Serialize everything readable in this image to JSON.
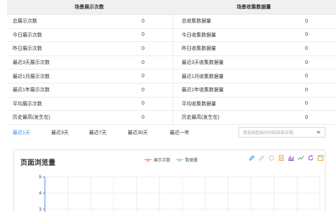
{
  "stats": {
    "left_title": "场景展示次数",
    "right_title": "场景收集数据量",
    "rows": [
      {
        "left_label": "总展示次数",
        "left_value": "0",
        "right_label": "总收集数据量",
        "right_value": "0"
      },
      {
        "left_label": "今日展示次数",
        "left_value": "0",
        "right_label": "今日收集数据量",
        "right_value": "0"
      },
      {
        "left_label": "昨日展示次数",
        "left_value": "0",
        "right_label": "昨日收集数据量",
        "right_value": "0"
      },
      {
        "left_label": "最近3天展示次数",
        "left_value": "0",
        "right_label": "最近3天收集数据量",
        "right_value": "0"
      },
      {
        "left_label": "最近1月展示次数",
        "left_value": "0",
        "right_label": "最近1月收集数据量",
        "right_value": "0"
      },
      {
        "left_label": "最近1年展示次数",
        "left_value": "0",
        "right_label": "最近1年收集数据量",
        "right_value": "0"
      },
      {
        "left_label": "平均展示次数",
        "left_value": "0",
        "right_label": "平均收集数据量",
        "right_value": "0"
      },
      {
        "left_label": "历史最高(发生在)",
        "left_value": "0",
        "right_label": "历史最高(发生在)",
        "right_value": "0"
      }
    ]
  },
  "range_tabs": {
    "items": [
      "最近1天",
      "最近3天",
      "最近7天",
      "最近30天",
      "最近一年"
    ],
    "active_index": 0
  },
  "date_picker": {
    "placeholder": "请选择起始时间和结束日期"
  },
  "chart_panel": {
    "title": "页面浏览量",
    "tools": [
      "edit-icon",
      "edit-disabled-icon",
      "restore-icon",
      "data-view-icon",
      "bar-chart-icon",
      "line-chart-icon",
      "refresh-icon",
      "save-image-icon"
    ],
    "tool_colors": [
      "#3b8ee3",
      "#c8c8c8",
      "#c8c8c8",
      "#f0a040",
      "#7a4fc8",
      "#4cb050",
      "#7a4fc8",
      "#f0a040"
    ]
  },
  "chart_data": {
    "type": "line",
    "title": "页面浏览量",
    "xlabel": "",
    "ylabel": "",
    "ylim": [
      0,
      5
    ],
    "y_ticks": [
      "5",
      "4",
      "3"
    ],
    "grid": true,
    "legend_position": "top-center",
    "series": [
      {
        "name": "展示次数",
        "color": "#f4794a",
        "values": []
      },
      {
        "name": "数据量",
        "color": "#7fc5e3",
        "values": []
      }
    ]
  },
  "colors": {
    "accent": "#3b8ee3",
    "header_bg": "#f0f0f0",
    "border": "#e8e8e8"
  }
}
